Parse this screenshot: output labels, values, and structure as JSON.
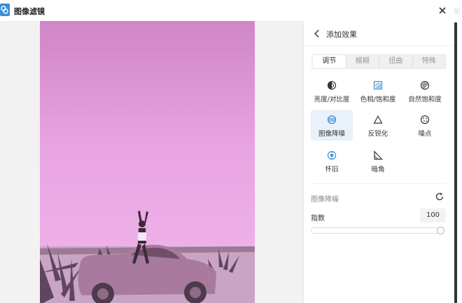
{
  "window": {
    "title": "图像滤镜",
    "ghost_text": "星"
  },
  "panel": {
    "header": {
      "title": "添加效果"
    },
    "tabs": [
      {
        "label": "调节",
        "active": true
      },
      {
        "label": "模糊",
        "active": false
      },
      {
        "label": "扭曲",
        "active": false
      },
      {
        "label": "特殊",
        "active": false
      }
    ],
    "effects": [
      {
        "label": "亮度/对比度",
        "icon": "brightness-contrast-icon",
        "selected": false
      },
      {
        "label": "色相/饱和度",
        "icon": "hue-saturation-icon",
        "selected": false
      },
      {
        "label": "自然饱和度",
        "icon": "vibrance-icon",
        "selected": false
      },
      {
        "label": "图像降噪",
        "icon": "denoise-icon",
        "selected": true
      },
      {
        "label": "反锐化",
        "icon": "unsharp-icon",
        "selected": false
      },
      {
        "label": "噪点",
        "icon": "noise-icon",
        "selected": false
      },
      {
        "label": "怀旧",
        "icon": "vintage-icon",
        "selected": false
      },
      {
        "label": "暗角",
        "icon": "vignette-icon",
        "selected": false
      }
    ],
    "settings": {
      "section_title": "图像降噪",
      "param_label": "指数",
      "param_value": "100",
      "slider_fraction": 1.0
    }
  },
  "colors": {
    "accent": "#3b8fd9",
    "photo_tint": "#e69fe0",
    "selected_bg": "#e9f1fb"
  }
}
